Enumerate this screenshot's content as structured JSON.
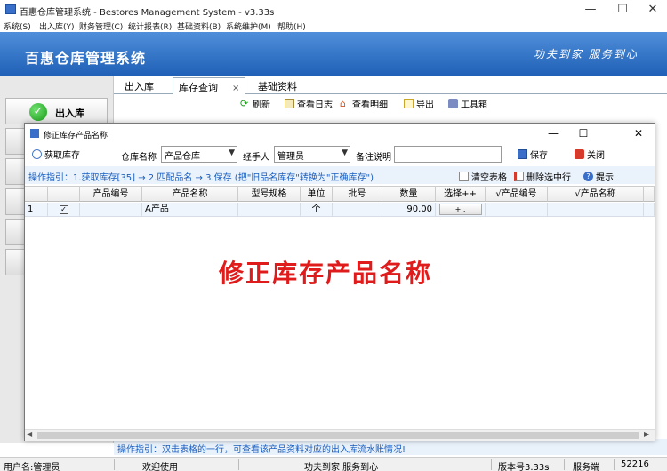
{
  "app": {
    "title": "百惠仓库管理系统 - Bestores Management System - v3.33s",
    "brand": "百惠仓库管理系统",
    "slogan": "功夫到家  服务到心"
  },
  "menu": [
    "系统(S)",
    "出入库(Y)",
    "财务管理(C)",
    "统计报表(R)",
    "基础资料(B)",
    "系统维护(M)",
    "帮助(H)"
  ],
  "sidebar": {
    "primary_label": "出入库"
  },
  "tabs": [
    {
      "label": "出入库"
    },
    {
      "label": "库存查询",
      "close": "×"
    },
    {
      "label": "基础资料"
    }
  ],
  "toolbar": {
    "refresh": "刷新",
    "view_log": "查看日志",
    "view_detail": "查看明细",
    "export": "导出",
    "toolbox": "工具箱"
  },
  "dialog": {
    "title": "修正库存产品名称",
    "fetch_stock": "获取库存",
    "warehouse_label": "仓库名称",
    "warehouse_value": "产品仓库",
    "handler_label": "经手人",
    "handler_value": "管理员",
    "remark_label": "备注说明",
    "remark_value": "",
    "save": "保存",
    "close": "关闭",
    "guide": "操作指引：1.获取库存[35] → 2.匹配品名 → 3.保存 (把\"旧品名库存\"转换为\"正确库存\")",
    "clear_table": "清空表格",
    "delete_row": "删除选中行",
    "hint": "提示",
    "watermark": "修正库存产品名称"
  },
  "grid": {
    "columns": [
      "",
      "",
      "产品编号",
      "产品名称",
      "型号规格",
      "单位",
      "批号",
      "数量",
      "选择++",
      "√产品编号",
      "√产品名称"
    ],
    "rows": [
      {
        "index": "1",
        "checked": "✓",
        "code": "",
        "name": "A产品",
        "spec": "",
        "unit": "个",
        "batch": "",
        "qty": "90.00",
        "pick": "+..",
        "new_code": "",
        "new_name": ""
      }
    ]
  },
  "bottom_guide": "操作指引：双击表格的一行，可查看该产品资料对应的出入库流水账情况!",
  "status": {
    "user": "用户名:管理员",
    "welcome": "欢迎使用",
    "motto": "功夫到家 服务到心",
    "version": "版本号3.33s",
    "server": "服务端",
    "port": "52216"
  }
}
